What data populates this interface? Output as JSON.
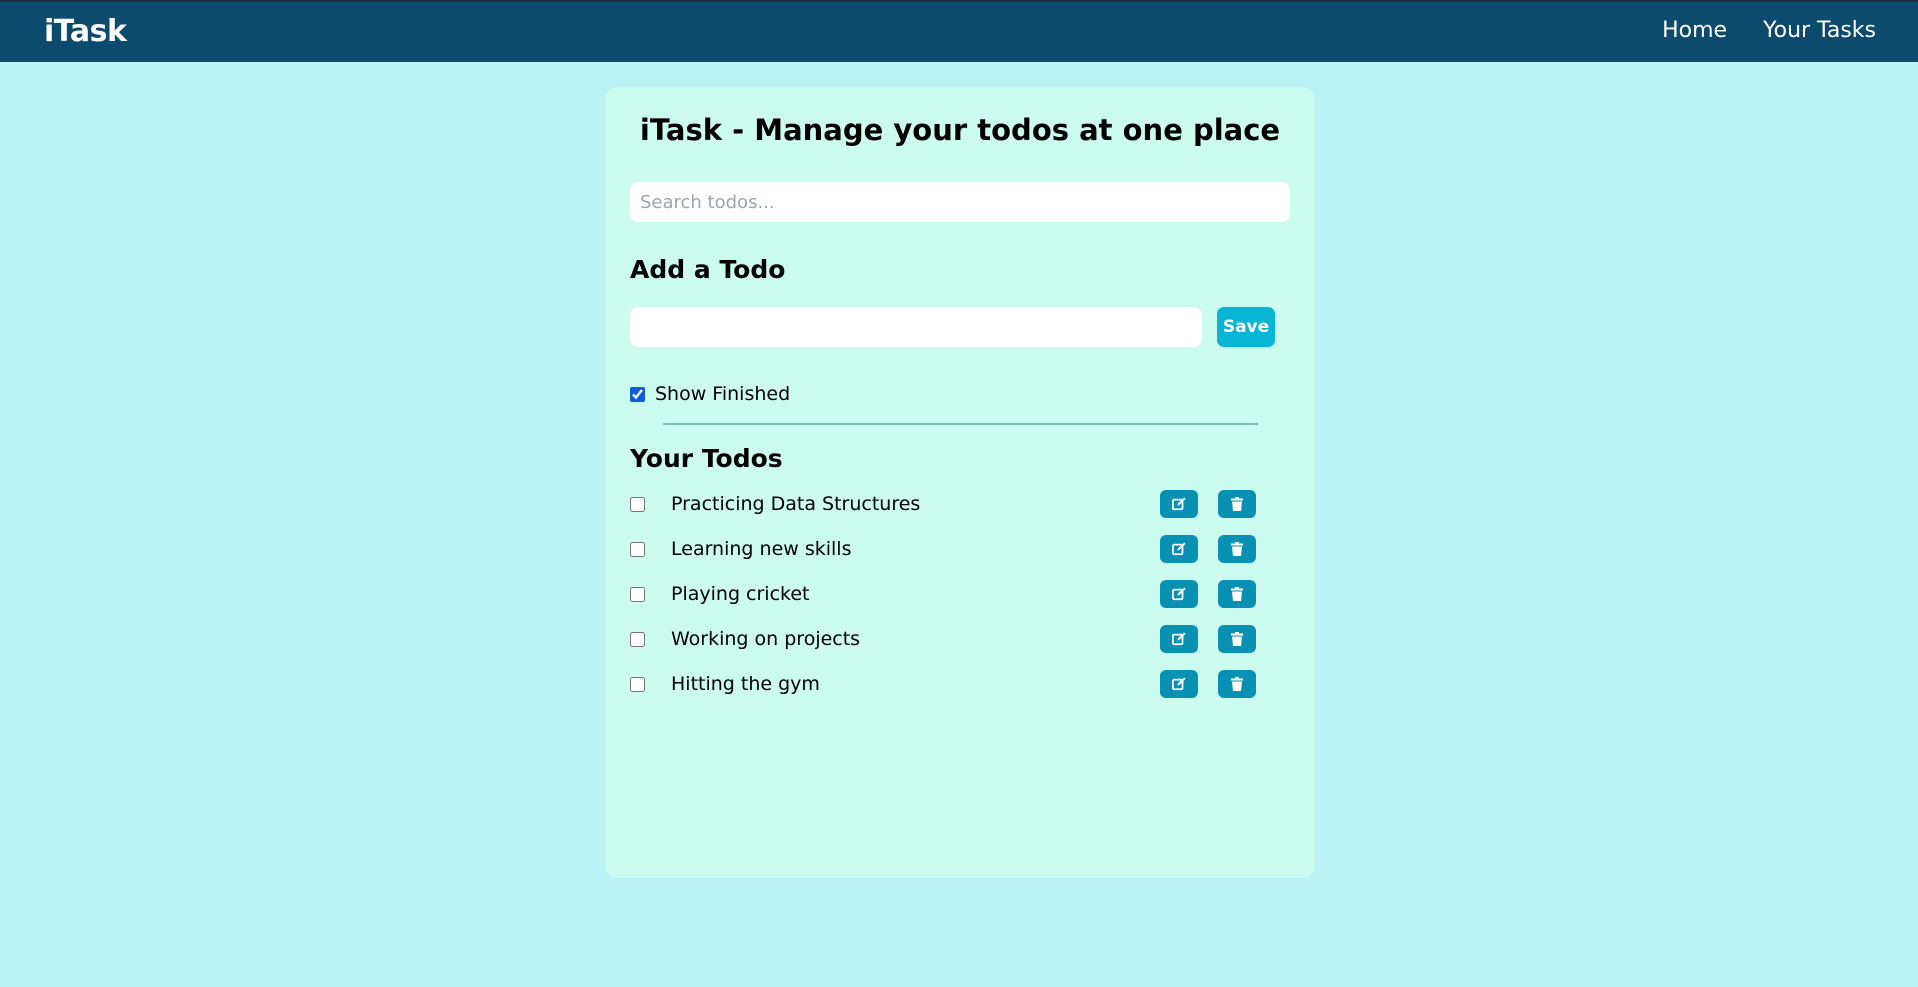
{
  "header": {
    "brand": "iTask",
    "nav": [
      {
        "label": "Home"
      },
      {
        "label": "Your Tasks"
      }
    ]
  },
  "main": {
    "title": "iTask - Manage your todos at one place",
    "search": {
      "placeholder": "Search todos...",
      "value": ""
    },
    "add_heading": "Add a Todo",
    "add_input": {
      "value": "",
      "placeholder": ""
    },
    "save_label": "Save",
    "show_finished": {
      "label": "Show Finished",
      "checked": true
    },
    "todos_heading": "Your Todos",
    "todos": [
      {
        "text": "Practicing Data Structures",
        "done": false
      },
      {
        "text": "Learning new skills",
        "done": false
      },
      {
        "text": "Playing cricket",
        "done": false
      },
      {
        "text": "Working on projects",
        "done": false
      },
      {
        "text": "Hitting the gym",
        "done": false
      }
    ],
    "icons": {
      "edit": "edit-icon",
      "delete": "trash-icon"
    }
  },
  "colors": {
    "page_bg": "#b8f2f4",
    "header_bg": "#0c4a6e",
    "card_bg": "#ccfbef",
    "save_bg": "#06b6d4",
    "action_bg": "#0891b2"
  }
}
